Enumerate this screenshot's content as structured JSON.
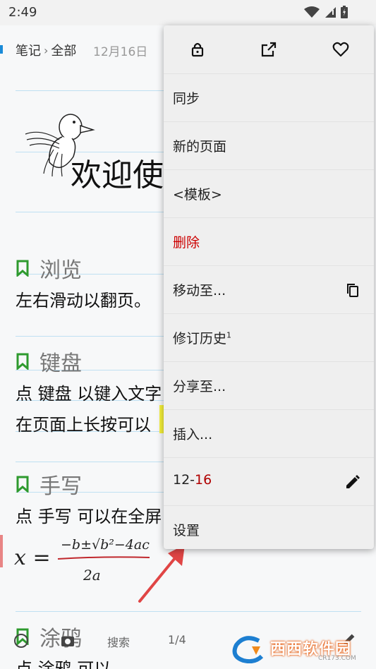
{
  "status_bar": {
    "time": "2:49"
  },
  "breadcrumb": {
    "root": "笔记",
    "folder": "全部",
    "date": "12月16日"
  },
  "page": {
    "welcome_text": "欢迎使",
    "sections": [
      {
        "title": "浏览",
        "lines": [
          "左右滑动以翻页。"
        ]
      },
      {
        "title": "键盘",
        "lines": [
          "点 键盘 以键入文字",
          "在页面上长按可以"
        ]
      },
      {
        "title": "手写",
        "lines": [
          "点 手写 可以在全屏"
        ]
      },
      {
        "title": "涂鸦",
        "lines": [
          "点 涂鸦 可以"
        ]
      }
    ],
    "formula": {
      "lhs": "x =",
      "numerator": "−b±√b²−4ac",
      "denominator": "2a"
    }
  },
  "bottom_bar": {
    "search_label": "搜索",
    "page_indicator": "1/4"
  },
  "menu": {
    "top_icons": [
      "lock-icon",
      "open-external-icon",
      "heart-icon"
    ],
    "items": [
      {
        "label": "同步"
      },
      {
        "label": "新的页面"
      },
      {
        "label": "<模板>"
      },
      {
        "label": "删除",
        "color": "#cc0000"
      },
      {
        "label": "移动至...",
        "trailing_icon": "copy-icon"
      },
      {
        "label": "修订历史",
        "superscript": "1"
      },
      {
        "label": "分享至..."
      },
      {
        "label": "插入..."
      },
      {
        "label_prefix": "12-",
        "label_suffix": "16",
        "trailing_icon": "pencil-icon"
      },
      {
        "label": "设置"
      }
    ]
  },
  "watermark": {
    "text": "西西软件园",
    "url": "CR173.COM"
  },
  "colors": {
    "accent_blue": "#1a8bd8",
    "rule_line": "#bfe0f2",
    "section_bookmark": "#2e9a2e",
    "highlight": "#f5f03a",
    "arrow": "#e04545"
  }
}
